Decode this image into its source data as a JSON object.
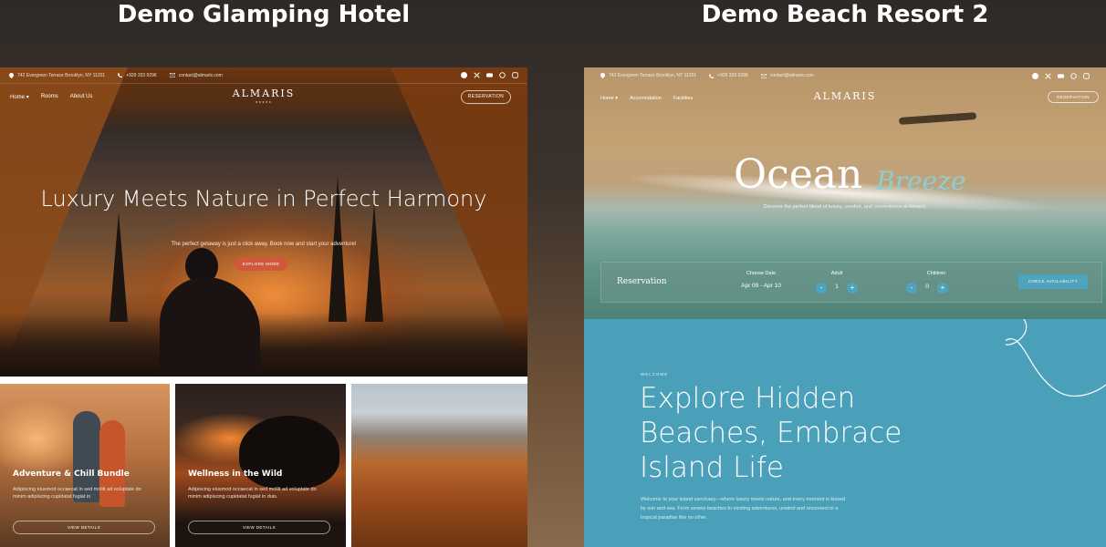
{
  "titles": {
    "left": "Demo Glamping Hotel",
    "right": "Demo Beach Resort 2"
  },
  "glamping": {
    "topbar": {
      "address": "742 Evergreen Terrace Brooklyn, NY 11201",
      "phone": "+929 333 9296",
      "email": "contact@almaris.com"
    },
    "social_icons": [
      "facebook-icon",
      "x-icon",
      "youtube-icon",
      "pinterest-icon",
      "instagram-icon"
    ],
    "nav": [
      "Home",
      "Rooms",
      "About Us"
    ],
    "logo": "ALMARIS",
    "logo_stars": "★★★★★",
    "reservation_label": "RESERVATION",
    "hero_title": "Luxury Meets Nature in Perfect Harmony",
    "hero_subtitle": "The perfect getaway is just a click away. Book now and start your adventure!",
    "explore_button": "EXPLORE MORE",
    "cards": [
      {
        "title": "Adventure & Chill Bundle",
        "desc": "Adipiscing eiusmod occaecat in sed mollit ad voluptate do minim adipiscing cupidatat fugiat in",
        "button": "VIEW DETAILS"
      },
      {
        "title": "Wellness in the Wild",
        "desc": "Adipiscing eiusmod occaecat in sed mollit ad voluptate do minim adipiscing cupidatat fugiat in duis.",
        "button": "VIEW DETAILS"
      }
    ]
  },
  "beach": {
    "topbar": {
      "address": "742 Evergreen Terrace Brooklyn, NY 11201",
      "phone": "+929 333 9296",
      "email": "contact@almaris.com"
    },
    "social_icons": [
      "facebook-icon",
      "x-icon",
      "youtube-icon",
      "pinterest-icon",
      "instagram-icon"
    ],
    "nav": [
      "Home",
      "Accomodation",
      "Facilities"
    ],
    "logo": "ALMARIS",
    "reservation_label": "RESERVATION",
    "hero_word": "Ocean",
    "hero_script": "Breeze",
    "hero_subtitle": "Discover the perfect blend of luxury, comfort, and convenience at Almaris.",
    "reservation_bar": {
      "label": "Reservation",
      "date_label": "Choose Date",
      "date_value": "Apr 09 - Apr 10",
      "adult_label": "Adult",
      "adult_value": "1",
      "children_label": "Children",
      "children_value": "0",
      "minus": "-",
      "plus": "+",
      "check_button": "CHECK AVAILABILITY"
    },
    "welcome_tag": "WELCOME",
    "explore_title": "Explore Hidden Beaches, Embrace Island Life",
    "explore_text": "Welcome to your island sanctuary—where luxury meets nature, and every moment is kissed by sun and sea. From serene beaches to exciting adventures, unwind and reconnect in a tropical paradise like no other.",
    "colors": {
      "accent": "#4aa0b9",
      "button": "#4ea4bd"
    }
  },
  "colors": {
    "glamping_accent": "#d2583d"
  }
}
